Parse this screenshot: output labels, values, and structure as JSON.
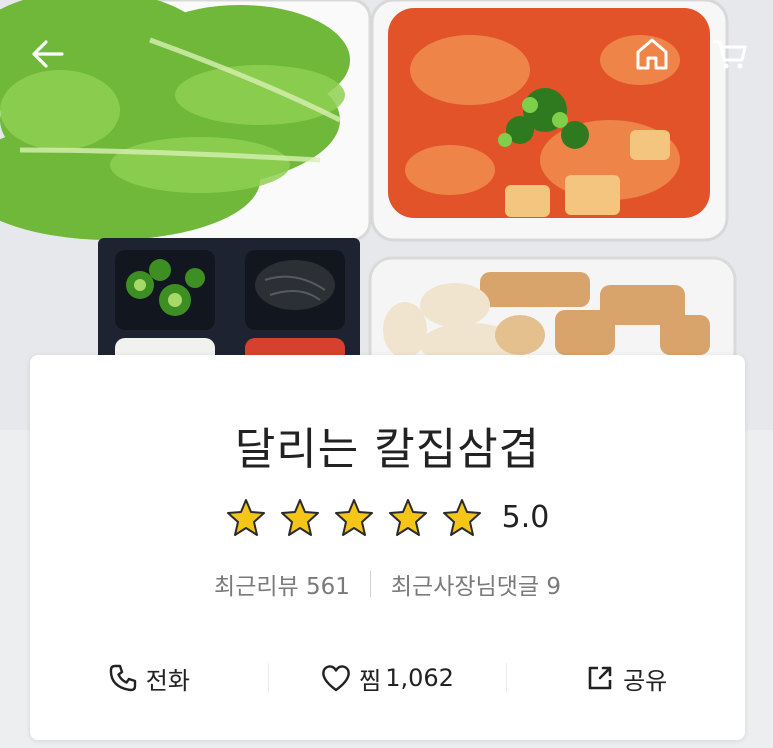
{
  "store": {
    "name": "달리는 칼집삼겹",
    "rating": "5.0",
    "rating_value": 5,
    "rating_max": 5
  },
  "meta": {
    "recent_reviews_label": "최근리뷰",
    "recent_reviews_count": "561",
    "owner_replies_label": "최근사장님댓글",
    "owner_replies_count": "9"
  },
  "actions": {
    "call_label": "전화",
    "like_label": "찜",
    "like_count": "1,062",
    "share_label": "공유"
  },
  "icons": {
    "back": "arrow-left-icon",
    "home": "home-icon",
    "cart": "cart-icon",
    "star": "star-icon",
    "phone": "phone-icon",
    "heart": "heart-icon",
    "share": "share-icon"
  },
  "colors": {
    "star_fill": "#f5c518",
    "star_outline": "#2b2b2b",
    "text_primary": "#222222",
    "text_secondary": "#7a7a7a"
  }
}
